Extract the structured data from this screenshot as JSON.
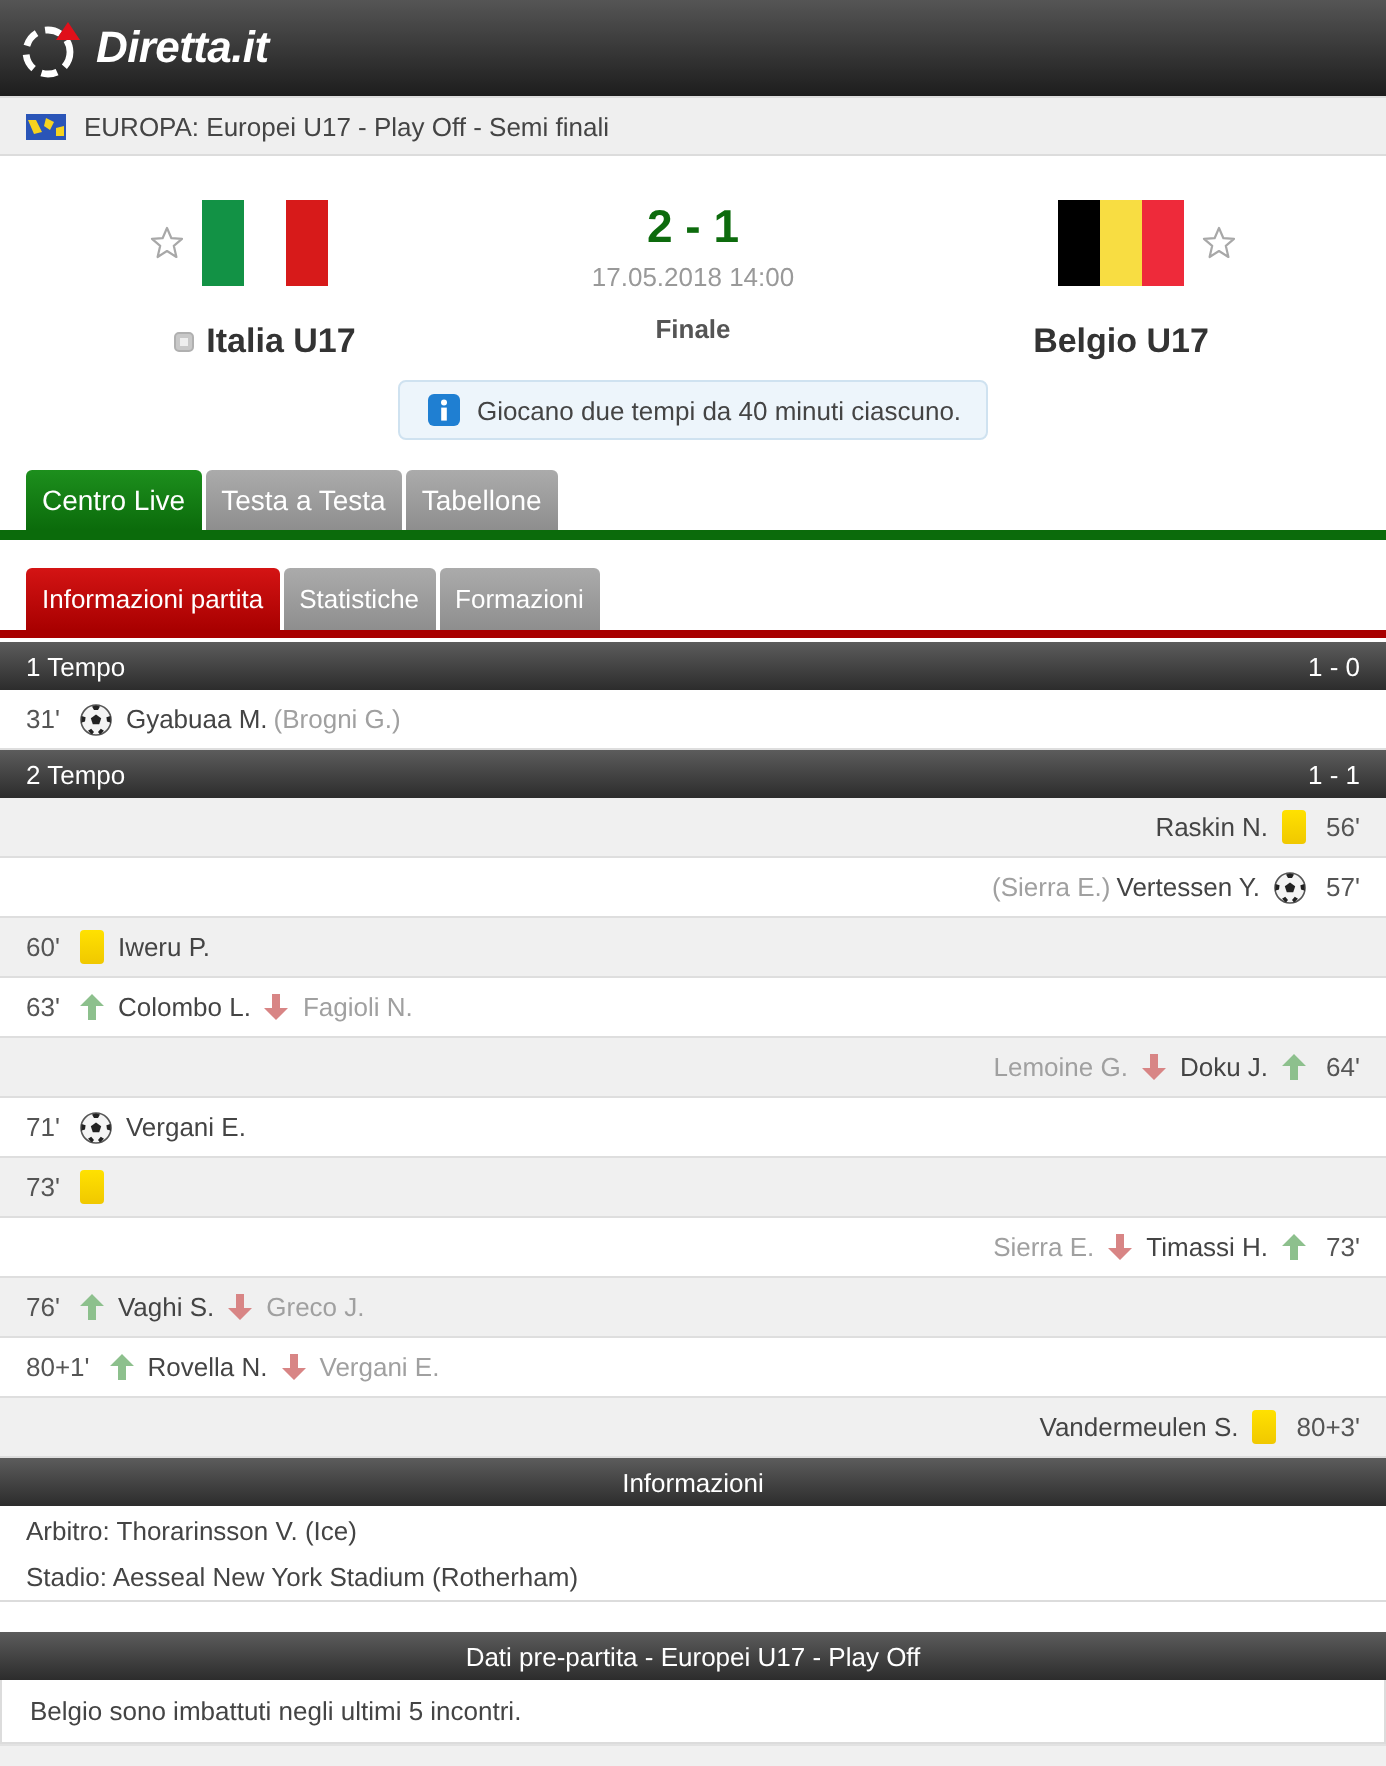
{
  "header": {
    "logo_text": "Diretta.it"
  },
  "breadcrumb": {
    "text": "EUROPA: Europei U17 - Play Off - Semi finali"
  },
  "match": {
    "teams": [
      {
        "name": "Italia U17",
        "favorite": false,
        "indicator": true,
        "flag_stripes": [
          {
            "color": "#129245"
          },
          {
            "color": "#ffffff"
          },
          {
            "color": "#d71a1a"
          }
        ]
      },
      {
        "name": "Belgio U17",
        "favorite": false,
        "indicator": false,
        "flag_stripes": [
          {
            "color": "#000000"
          },
          {
            "color": "#f8dd42"
          },
          {
            "color": "#ee2a3a"
          }
        ]
      }
    ],
    "score": "2 - 1",
    "datetime": "17.05.2018 14:00",
    "status": "Finale",
    "note": "Giocano due tempi da 40 minuti ciascuno."
  },
  "tabs": [
    {
      "label": "Centro Live",
      "selected": true
    },
    {
      "label": "Testa a Testa",
      "selected": false
    },
    {
      "label": "Tabellone",
      "selected": false
    }
  ],
  "subtabs": [
    {
      "label": "Informazioni partita",
      "selected": true
    },
    {
      "label": "Statistiche",
      "selected": false
    },
    {
      "label": "Formazioni",
      "selected": false
    }
  ],
  "periods": [
    {
      "title": "1 Tempo",
      "score": "1 - 0",
      "events": [
        {
          "away": false,
          "kind": "goal",
          "time": "31'",
          "player": "Gyabuaa M.",
          "assist": "(Brogni G.)"
        }
      ]
    },
    {
      "title": "2 Tempo",
      "score": "1 - 1",
      "events": [
        {
          "away": true,
          "kind": "yellow_card",
          "time": "56'",
          "player": "Raskin N."
        },
        {
          "away": true,
          "kind": "goal",
          "time": "57'",
          "player": "Vertessen Y.",
          "assist": "(Sierra E.)"
        },
        {
          "away": false,
          "kind": "yellow_card",
          "time": "60'",
          "player": "Iweru P."
        },
        {
          "away": false,
          "kind": "substitution",
          "time": "63'",
          "player": "Colombo L.",
          "player_out": "Fagioli N."
        },
        {
          "away": true,
          "kind": "substitution",
          "time": "64'",
          "player": "Doku J.",
          "player_out": "Lemoine G."
        },
        {
          "away": false,
          "kind": "goal",
          "time": "71'",
          "player": "Vergani E."
        },
        {
          "away": false,
          "kind": "yellow_card",
          "time": "73'"
        },
        {
          "away": true,
          "kind": "substitution",
          "time": "73'",
          "player": "Timassi H.",
          "player_out": "Sierra E."
        },
        {
          "away": false,
          "kind": "substitution",
          "time": "76'",
          "player": "Vaghi S.",
          "player_out": "Greco J."
        },
        {
          "away": false,
          "kind": "substitution",
          "time": "80+1'",
          "player": "Rovella N.",
          "player_out": "Vergani E."
        },
        {
          "away": true,
          "kind": "yellow_card",
          "time": "80+3'",
          "player": "Vandermeulen S."
        }
      ]
    }
  ],
  "info": {
    "title": "Informazioni",
    "lines": [
      "Arbitro: Thorarinsson V. (Ice)",
      "Stadio: Aesseal New York Stadium (Rotherham)"
    ]
  },
  "prematch": {
    "title": "Dati pre-partita - Europei U17 - Play Off",
    "text": "Belgio sono imbattuti negli ultimi 5 incontri."
  }
}
